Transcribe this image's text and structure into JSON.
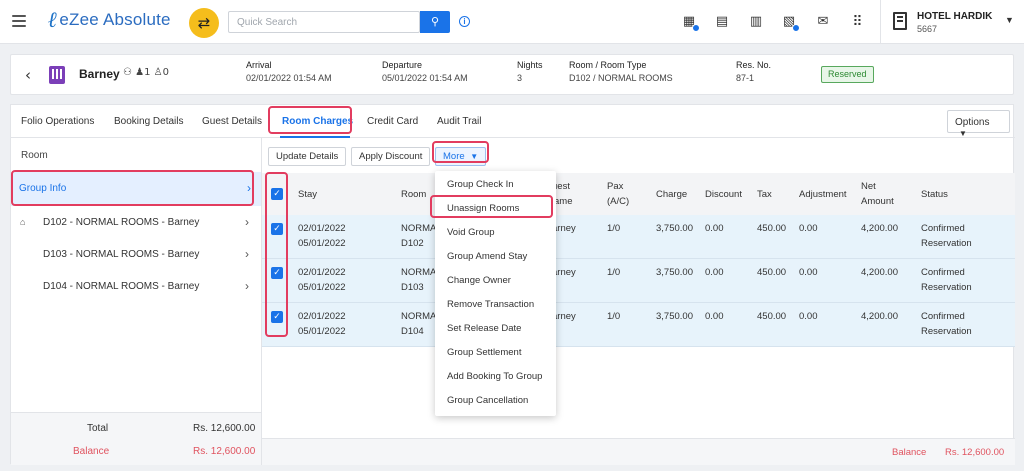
{
  "app": {
    "logo": "eZee Absolute",
    "search_placeholder": "Quick Search",
    "hotel_name": "HOTEL HARDIK",
    "hotel_id": "5667"
  },
  "reservation": {
    "guest": "Barney",
    "pax_adults": "1",
    "pax_children": "0",
    "arrival_label": "Arrival",
    "arrival": "02/01/2022 01:54 AM",
    "departure_label": "Departure",
    "departure": "05/01/2022 01:54 AM",
    "nights_label": "Nights",
    "nights": "3",
    "room_label": "Room / Room Type",
    "room": "D102 / NORMAL ROOMS",
    "resno_label": "Res. No.",
    "resno": "87-1",
    "status": "Reserved"
  },
  "tabs": [
    "Folio Operations",
    "Booking Details",
    "Guest Details",
    "Room Charges",
    "Credit Card",
    "Audit Trail"
  ],
  "options_label": "Options",
  "sidebar": {
    "header": "Room",
    "group": "Group Info",
    "rooms": [
      "D102 - NORMAL ROOMS - Barney",
      "D103 - NORMAL ROOMS - Barney",
      "D104 - NORMAL ROOMS - Barney"
    ],
    "total_label": "Total",
    "total": "Rs. 12,600.00",
    "balance_label": "Balance",
    "balance": "Rs. 12,600.00"
  },
  "toolbar": {
    "update": "Update Details",
    "discount": "Apply Discount",
    "more": "More"
  },
  "table": {
    "headers": {
      "stay": "Stay",
      "room": "Room",
      "guest_a": "uest",
      "guest_b": "ame",
      "pax_a": "Pax",
      "pax_b": "(A/C)",
      "charge": "Charge",
      "discount": "Discount",
      "tax": "Tax",
      "adjustment": "Adjustment",
      "net_a": "Net",
      "net_b": "Amount",
      "status": "Status"
    },
    "rows": [
      {
        "stay_from": "02/01/2022",
        "stay_to": "05/01/2022",
        "room_a": "NORMA",
        "room_b": "D102",
        "guest": "arney",
        "pax": "1/0",
        "charge": "3,750.00",
        "discount": "0.00",
        "tax": "450.00",
        "adjustment": "0.00",
        "net": "4,200.00",
        "status_a": "Confirmed",
        "status_b": "Reservation"
      },
      {
        "stay_from": "02/01/2022",
        "stay_to": "05/01/2022",
        "room_a": "NORMA",
        "room_b": "D103",
        "guest": "arney",
        "pax": "1/0",
        "charge": "3,750.00",
        "discount": "0.00",
        "tax": "450.00",
        "adjustment": "0.00",
        "net": "4,200.00",
        "status_a": "Confirmed",
        "status_b": "Reservation"
      },
      {
        "stay_from": "02/01/2022",
        "stay_to": "05/01/2022",
        "room_a": "NORMA",
        "room_b": "D104",
        "guest": "arney",
        "pax": "1/0",
        "charge": "3,750.00",
        "discount": "0.00",
        "tax": "450.00",
        "adjustment": "0.00",
        "net": "4,200.00",
        "status_a": "Confirmed",
        "status_b": "Reservation"
      }
    ],
    "footer_balance_label": "Balance",
    "footer_balance": "Rs. 12,600.00"
  },
  "more_menu": [
    "Group Check In",
    "Unassign Rooms",
    "Void Group",
    "Group Amend Stay",
    "Change Owner",
    "Remove Transaction",
    "Set Release Date",
    "Group Settlement",
    "Add Booking To Group",
    "Group Cancellation"
  ],
  "colors": {
    "accent": "#1a73e8",
    "highlight": "#e23c5f",
    "balance": "#e0535f",
    "reserved": "#2e8a33"
  }
}
